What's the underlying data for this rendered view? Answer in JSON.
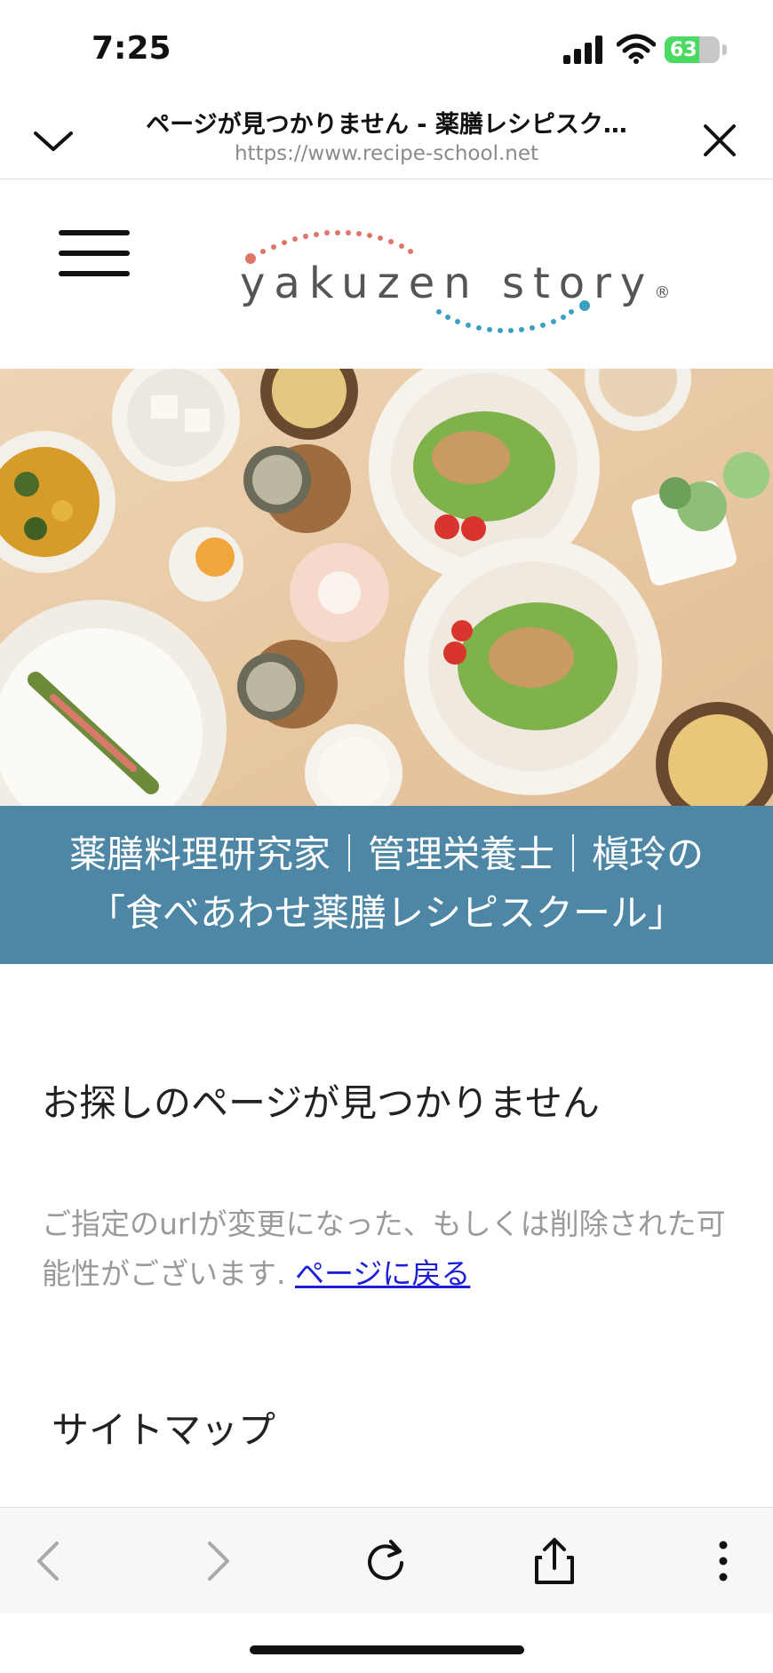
{
  "status_bar": {
    "time": "7:25",
    "battery": "63"
  },
  "browser": {
    "title": "ページが見つかりません - 薬膳レシピスク…",
    "url": "https://www.recipe-school.net"
  },
  "site": {
    "logo_text": "yakuzen story",
    "logo_mark": "®",
    "banner_line1": "薬膳料理研究家｜管理栄養士｜槇玲の",
    "banner_line2": "「食べあわせ薬膳レシピスクール」"
  },
  "content": {
    "heading": "お探しのページが見つかりません",
    "description": "ご指定のurlが変更になった、もしくは削除された可能性がございます.",
    "back_link": "ページに戻る",
    "sitemap_heading": "サイトマップ"
  },
  "colors": {
    "banner_bg": "#4e87a5",
    "link": "#1d1fd8",
    "logo_dots_top": "#e0766a",
    "logo_dots_bottom": "#3aa0c2"
  },
  "icons": {
    "collapse": "chevron-down-icon",
    "close": "close-icon",
    "menu": "hamburger-menu-icon",
    "back": "chevron-left-icon",
    "forward": "chevron-right-icon",
    "reload": "reload-icon",
    "share": "share-icon",
    "more": "more-vertical-icon"
  }
}
